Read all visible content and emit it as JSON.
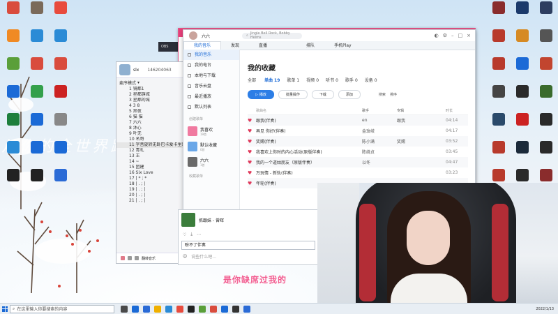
{
  "desktop": {
    "wallpaper_text": "从你的全世界路过",
    "left_icons": [
      {
        "label": "",
        "color": "#d94c3d"
      },
      {
        "label": "",
        "color": "#f08a24"
      },
      {
        "label": "",
        "color": "#5a9f3a"
      },
      {
        "label": "",
        "color": "#1b6ad6"
      },
      {
        "label": "",
        "color": "#1e7f3c"
      },
      {
        "label": "",
        "color": "#2b8bd6"
      },
      {
        "label": "",
        "color": "#222"
      },
      {
        "label": "",
        "color": "#7a6a5a"
      },
      {
        "label": "",
        "color": "#2b8bd6"
      },
      {
        "label": "",
        "color": "#d94c3d"
      },
      {
        "label": "",
        "color": "#33a04b"
      },
      {
        "label": "",
        "color": "#1b6ad6"
      },
      {
        "label": "",
        "color": "#1b6ad6"
      },
      {
        "label": "",
        "color": "#222"
      },
      {
        "label": "",
        "color": "#e84b3d"
      },
      {
        "label": "",
        "color": "#2b8bd6"
      },
      {
        "label": "",
        "color": "#d94c3d"
      },
      {
        "label": "",
        "color": "#c22"
      },
      {
        "label": "",
        "color": "#888"
      },
      {
        "label": "",
        "color": "#1b6ad6"
      },
      {
        "label": "",
        "color": "#2b6bd6"
      }
    ],
    "right_icons": [
      {
        "label": "",
        "color": "#8a2c2c"
      },
      {
        "label": "",
        "color": "#1b3a6b"
      },
      {
        "label": "",
        "color": "#2d3e60"
      },
      {
        "label": "",
        "color": "#b83a2c"
      },
      {
        "label": "",
        "color": "#d68a24"
      },
      {
        "label": "",
        "color": "#555"
      },
      {
        "label": "",
        "color": "#b83a2c"
      },
      {
        "label": "",
        "color": "#1b6ad6"
      },
      {
        "label": "",
        "color": "#c2452f"
      },
      {
        "label": "",
        "color": "#444"
      },
      {
        "label": "",
        "color": "#2a2a2a"
      },
      {
        "label": "",
        "color": "#3a6b2c"
      },
      {
        "label": "",
        "color": "#2a4a6b"
      },
      {
        "label": "",
        "color": "#c22"
      },
      {
        "label": "",
        "color": "#2a2a2a"
      },
      {
        "label": "",
        "color": "#b83a2c"
      },
      {
        "label": "",
        "color": "#1b2a3a"
      },
      {
        "label": "",
        "color": "#2a2a2a"
      },
      {
        "label": "",
        "color": "#b83a2c"
      },
      {
        "label": "",
        "color": "#2a2a2a"
      },
      {
        "label": "",
        "color": "#8a2c2c"
      },
      {
        "label": "",
        "color": "#b83a2c"
      },
      {
        "label": "",
        "color": "#c22"
      }
    ]
  },
  "obs": {
    "title": "OBS"
  },
  "chat": {
    "group_name": "slx",
    "group_id": "146204063",
    "mode": "麦序模式",
    "rows": [
      "1 镜都1",
      "2 星都旗城",
      "3 星都的城",
      "4 3 8",
      "5 黑夜",
      "6 猫 猫",
      "7 六六",
      "8 沐心",
      "9 叶无",
      "10 名哥",
      "11 字音旋转无卧巴卡爱卡里乐",
      "12 青礼",
      "13 王",
      "14 ~",
      "15 团建",
      "16 Six Love",
      "17 | * ; *",
      "18 | . ; |",
      "19 | . ; |",
      "20 | . ; |",
      "21 | . ; |"
    ],
    "footer": [
      "自由",
      "麦序",
      "",
      "",
      "",
      "翻转音乐",
      "",
      "播放伴奏",
      "",
      "设置"
    ]
  },
  "music": {
    "user": "六六",
    "search_placeholder": "Jingle Bell Rock, Bobby Helms",
    "tabs": [
      "我的音乐",
      "发现",
      "直播",
      "",
      "排队",
      "手机Play"
    ],
    "sidebar": {
      "items": [
        "我的音乐",
        "我的电台",
        "本地与下载",
        "音乐云盘",
        "最近播放",
        "默认列表"
      ],
      "created_header": "创建歌单",
      "playlists": [
        {
          "name": "我喜欢",
          "count": "19首",
          "color": "#f07aa0"
        },
        {
          "name": "默认收藏",
          "count": "0首",
          "color": "#6aa7e8"
        },
        {
          "name": "六六",
          "count": "1首",
          "color": "#6a6a6a"
        }
      ],
      "collected_header": "收藏歌单"
    },
    "title": "我的收藏",
    "subtabs": [
      {
        "label": "全部",
        "count": ""
      },
      {
        "label": "单曲",
        "count": "19"
      },
      {
        "label": "歌单",
        "count": "1"
      },
      {
        "label": "视频",
        "count": "0"
      },
      {
        "label": "听书",
        "count": "0"
      },
      {
        "label": "歌手",
        "count": "0"
      },
      {
        "label": "设备",
        "count": "0"
      }
    ],
    "actions": {
      "play": "播放",
      "batch": "批量操作",
      "download": "下载",
      "add": "添加",
      "search": "搜索",
      "sort": "排序"
    },
    "columns": {
      "title": "歌曲名",
      "artist": "歌手",
      "album": "专辑",
      "duration": "时长"
    },
    "songs": [
      {
        "title": "跟我(伴奏)",
        "artist": "en",
        "album": "跟我",
        "duration": "04:14"
      },
      {
        "title": "再见 你好(伴奏)",
        "artist": "金玟岐",
        "album": "",
        "duration": "04:17"
      },
      {
        "title": "奖赐(伴奏)",
        "artist": "陈小满",
        "album": "奖赐",
        "duration": "03:52"
      },
      {
        "title": "我喜欢上你时的内心活动(原版伴奏)",
        "artist": "陈绮贞",
        "album": "",
        "duration": "03:45"
      },
      {
        "title": "我的一个道姑朋友（原版伴奏）",
        "artist": "以冬",
        "album": "",
        "duration": "04:47"
      },
      {
        "title": "万玩情 - 新轨(伴奏)",
        "artist": "",
        "album": "",
        "duration": "03:23"
      },
      {
        "title": "年轮(伴奏)",
        "artist": "",
        "album": "",
        "duration": ""
      }
    ]
  },
  "player": {
    "now_playing": "抓跟妹 - 曾晖",
    "lyric": "盼不了伴奏",
    "input_placeholder": "说些什么吧...",
    "buttons": [
      "翻转音乐",
      "播放伴奏",
      "设置"
    ]
  },
  "caption": "是你缺席过我的",
  "taskbar": {
    "search_placeholder": "在这里输入你要搜索的内容",
    "time": "2022/1/13",
    "start_color": "#1b6ad6"
  }
}
